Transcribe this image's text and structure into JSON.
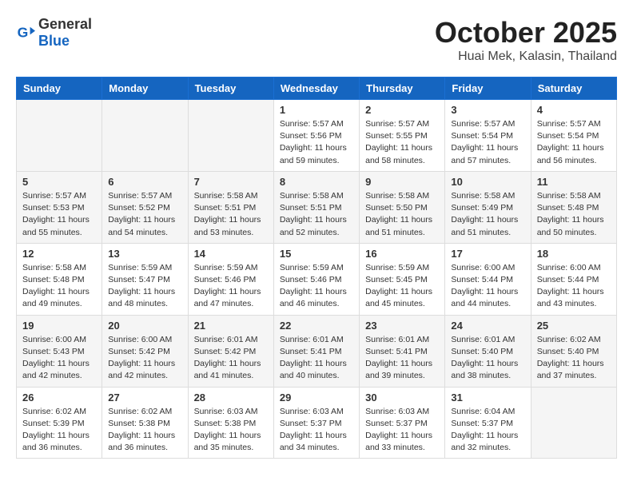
{
  "header": {
    "logo_general": "General",
    "logo_blue": "Blue",
    "month": "October 2025",
    "location": "Huai Mek, Kalasin, Thailand"
  },
  "weekdays": [
    "Sunday",
    "Monday",
    "Tuesday",
    "Wednesday",
    "Thursday",
    "Friday",
    "Saturday"
  ],
  "weeks": [
    [
      {
        "day": "",
        "info": ""
      },
      {
        "day": "",
        "info": ""
      },
      {
        "day": "",
        "info": ""
      },
      {
        "day": "1",
        "info": "Sunrise: 5:57 AM\nSunset: 5:56 PM\nDaylight: 11 hours\nand 59 minutes."
      },
      {
        "day": "2",
        "info": "Sunrise: 5:57 AM\nSunset: 5:55 PM\nDaylight: 11 hours\nand 58 minutes."
      },
      {
        "day": "3",
        "info": "Sunrise: 5:57 AM\nSunset: 5:54 PM\nDaylight: 11 hours\nand 57 minutes."
      },
      {
        "day": "4",
        "info": "Sunrise: 5:57 AM\nSunset: 5:54 PM\nDaylight: 11 hours\nand 56 minutes."
      }
    ],
    [
      {
        "day": "5",
        "info": "Sunrise: 5:57 AM\nSunset: 5:53 PM\nDaylight: 11 hours\nand 55 minutes."
      },
      {
        "day": "6",
        "info": "Sunrise: 5:57 AM\nSunset: 5:52 PM\nDaylight: 11 hours\nand 54 minutes."
      },
      {
        "day": "7",
        "info": "Sunrise: 5:58 AM\nSunset: 5:51 PM\nDaylight: 11 hours\nand 53 minutes."
      },
      {
        "day": "8",
        "info": "Sunrise: 5:58 AM\nSunset: 5:51 PM\nDaylight: 11 hours\nand 52 minutes."
      },
      {
        "day": "9",
        "info": "Sunrise: 5:58 AM\nSunset: 5:50 PM\nDaylight: 11 hours\nand 51 minutes."
      },
      {
        "day": "10",
        "info": "Sunrise: 5:58 AM\nSunset: 5:49 PM\nDaylight: 11 hours\nand 51 minutes."
      },
      {
        "day": "11",
        "info": "Sunrise: 5:58 AM\nSunset: 5:48 PM\nDaylight: 11 hours\nand 50 minutes."
      }
    ],
    [
      {
        "day": "12",
        "info": "Sunrise: 5:58 AM\nSunset: 5:48 PM\nDaylight: 11 hours\nand 49 minutes."
      },
      {
        "day": "13",
        "info": "Sunrise: 5:59 AM\nSunset: 5:47 PM\nDaylight: 11 hours\nand 48 minutes."
      },
      {
        "day": "14",
        "info": "Sunrise: 5:59 AM\nSunset: 5:46 PM\nDaylight: 11 hours\nand 47 minutes."
      },
      {
        "day": "15",
        "info": "Sunrise: 5:59 AM\nSunset: 5:46 PM\nDaylight: 11 hours\nand 46 minutes."
      },
      {
        "day": "16",
        "info": "Sunrise: 5:59 AM\nSunset: 5:45 PM\nDaylight: 11 hours\nand 45 minutes."
      },
      {
        "day": "17",
        "info": "Sunrise: 6:00 AM\nSunset: 5:44 PM\nDaylight: 11 hours\nand 44 minutes."
      },
      {
        "day": "18",
        "info": "Sunrise: 6:00 AM\nSunset: 5:44 PM\nDaylight: 11 hours\nand 43 minutes."
      }
    ],
    [
      {
        "day": "19",
        "info": "Sunrise: 6:00 AM\nSunset: 5:43 PM\nDaylight: 11 hours\nand 42 minutes."
      },
      {
        "day": "20",
        "info": "Sunrise: 6:00 AM\nSunset: 5:42 PM\nDaylight: 11 hours\nand 42 minutes."
      },
      {
        "day": "21",
        "info": "Sunrise: 6:01 AM\nSunset: 5:42 PM\nDaylight: 11 hours\nand 41 minutes."
      },
      {
        "day": "22",
        "info": "Sunrise: 6:01 AM\nSunset: 5:41 PM\nDaylight: 11 hours\nand 40 minutes."
      },
      {
        "day": "23",
        "info": "Sunrise: 6:01 AM\nSunset: 5:41 PM\nDaylight: 11 hours\nand 39 minutes."
      },
      {
        "day": "24",
        "info": "Sunrise: 6:01 AM\nSunset: 5:40 PM\nDaylight: 11 hours\nand 38 minutes."
      },
      {
        "day": "25",
        "info": "Sunrise: 6:02 AM\nSunset: 5:40 PM\nDaylight: 11 hours\nand 37 minutes."
      }
    ],
    [
      {
        "day": "26",
        "info": "Sunrise: 6:02 AM\nSunset: 5:39 PM\nDaylight: 11 hours\nand 36 minutes."
      },
      {
        "day": "27",
        "info": "Sunrise: 6:02 AM\nSunset: 5:38 PM\nDaylight: 11 hours\nand 36 minutes."
      },
      {
        "day": "28",
        "info": "Sunrise: 6:03 AM\nSunset: 5:38 PM\nDaylight: 11 hours\nand 35 minutes."
      },
      {
        "day": "29",
        "info": "Sunrise: 6:03 AM\nSunset: 5:37 PM\nDaylight: 11 hours\nand 34 minutes."
      },
      {
        "day": "30",
        "info": "Sunrise: 6:03 AM\nSunset: 5:37 PM\nDaylight: 11 hours\nand 33 minutes."
      },
      {
        "day": "31",
        "info": "Sunrise: 6:04 AM\nSunset: 5:37 PM\nDaylight: 11 hours\nand 32 minutes."
      },
      {
        "day": "",
        "info": ""
      }
    ]
  ]
}
